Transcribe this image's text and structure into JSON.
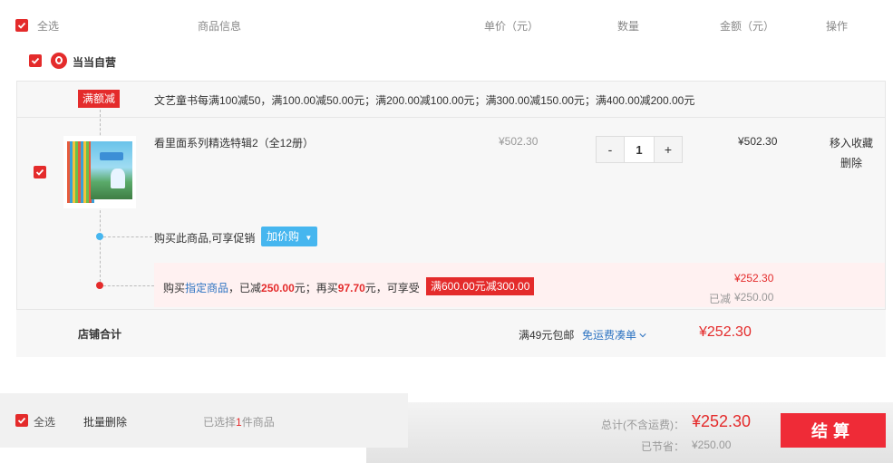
{
  "header": {
    "select_all": "全选",
    "col_info": "商品信息",
    "col_price": "单价（元）",
    "col_qty": "数量",
    "col_amount": "金额（元）",
    "col_action": "操作"
  },
  "store": {
    "name": "当当自营"
  },
  "promo": {
    "tag": "满额减",
    "text": "文艺童书每满100减50，满100.00减50.00元；满200.00减100.00元；满300.00减150.00元；满400.00减200.00元"
  },
  "item": {
    "title": "看里面系列精选特辑2（全12册）",
    "unit_price": "¥502.30",
    "quantity": "1",
    "amount": "¥502.30",
    "action_fav": "移入收藏",
    "action_delete": "删除",
    "minus": "-",
    "plus": "+"
  },
  "promo_line": {
    "text": "购买此商品,可享促销",
    "button": "加价购"
  },
  "discount": {
    "p1": "购买",
    "link": "指定商品",
    "p2": "，已减",
    "reduced": "250.00",
    "p3": "元；再买",
    "more": "97.70",
    "p4": "元，可享受",
    "tag": "满600.00元减300.00",
    "price": "¥252.30",
    "saved_label": "已减",
    "saved": "¥250.00"
  },
  "store_total": {
    "label": "店铺合计",
    "shipping": "满49元包邮",
    "free_ship_link": "免运费凑单",
    "total": "¥252.30"
  },
  "footer": {
    "select_all": "全选",
    "batch_delete": "批量删除",
    "selected_prefix": "已选择",
    "selected_count": "1",
    "selected_suffix": "件商品",
    "total_label": "总计(不含运费)：",
    "total": "¥252.30",
    "saved_label": "已节省：",
    "saved": "¥250.00",
    "checkout": "结算"
  },
  "colors": {
    "accent": "#e42b2b",
    "link": "#2e74c2",
    "promo_blue": "#46b6ef"
  }
}
